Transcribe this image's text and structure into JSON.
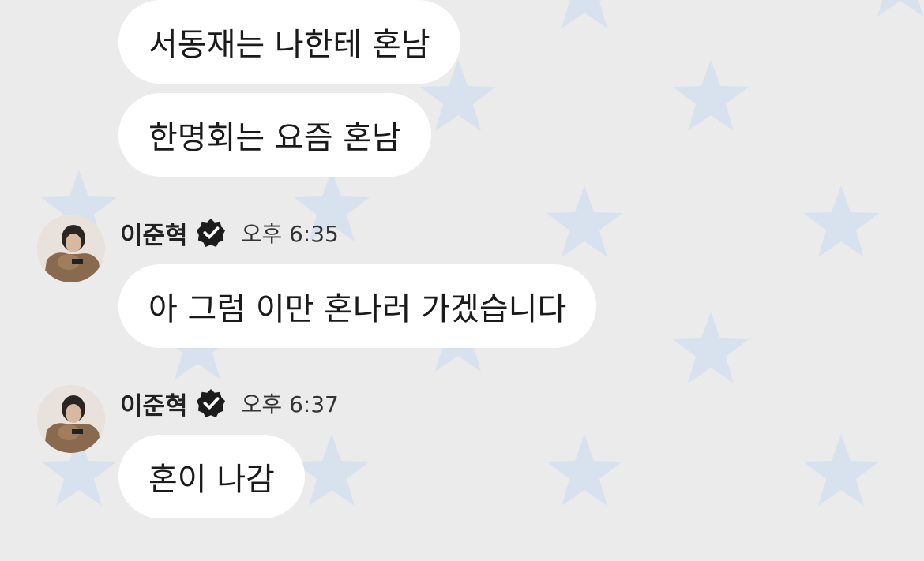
{
  "theme": {
    "background": "#ebebeb",
    "star_color": "#d8e2ee",
    "bubble_color": "#ffffff"
  },
  "messages_top": [
    {
      "text": "서동재는 나한테 혼남"
    },
    {
      "text": "한명회는 요즘 혼남"
    }
  ],
  "group1": {
    "sender": "이준혁",
    "verified_icon": "verified-badge-icon",
    "time": "오후 6:35",
    "text": "아 그럼 이만 혼나러 가겠습니다"
  },
  "group2": {
    "sender": "이준혁",
    "verified_icon": "verified-badge-icon",
    "time": "오후 6:37",
    "text": "혼이 나감"
  }
}
